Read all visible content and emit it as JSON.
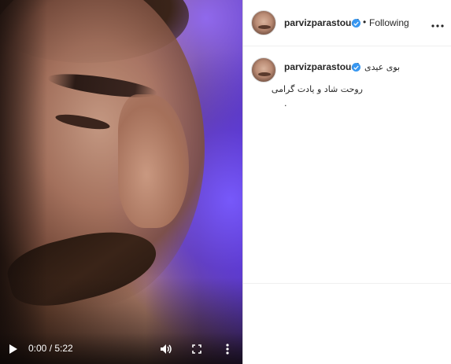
{
  "video": {
    "time": "0:00 / 5:22",
    "play_icon": "play-icon",
    "volume_icon": "volume-icon",
    "fullscreen_icon": "fullscreen-icon",
    "more_icon": "more-vertical-icon"
  },
  "header": {
    "username": "parvizparastouei",
    "separator": "•",
    "follow_status": "Following",
    "options_icon": "more-horizontal-icon"
  },
  "caption": {
    "username": "parvizparastouei",
    "line1": "بوی عیدی",
    "line2": "روحت شاد و یادت گرامی",
    "line3": "."
  },
  "colors": {
    "verified": "#3897f0",
    "text": "#262626",
    "border": "#dbdbdb"
  }
}
